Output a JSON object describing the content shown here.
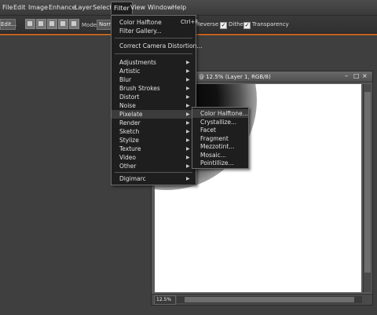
{
  "menubar": {
    "items": [
      "File",
      "Edit",
      "Image",
      "Enhance",
      "Layer",
      "Select",
      "Filter",
      "View",
      "Window",
      "Help"
    ]
  },
  "options_bar": {
    "edit_button": "Edit...",
    "mode_label": "Mode:",
    "mode_value": "Normal",
    "reverse": "Reverse",
    "dither": "Dither",
    "transparency": "Transparency",
    "check_mark": "✓"
  },
  "document": {
    "title": "@ 12.5% (Layer 1, RGB/8)",
    "zoom": "12.5%",
    "controls": {
      "minimize": "–",
      "maximize": "□",
      "close": "×"
    }
  },
  "filter_menu": {
    "items": [
      {
        "label": "Color Halftone",
        "shortcut": "Ctrl+F"
      },
      {
        "label": "Filter Gallery..."
      },
      {
        "label": "Correct Camera Distortion..."
      },
      {
        "label": "Adjustments",
        "arrow": "▶"
      },
      {
        "label": "Artistic",
        "arrow": "▶"
      },
      {
        "label": "Blur",
        "arrow": "▶"
      },
      {
        "label": "Brush Strokes",
        "arrow": "▶"
      },
      {
        "label": "Distort",
        "arrow": "▶"
      },
      {
        "label": "Noise",
        "arrow": "▶"
      },
      {
        "label": "Pixelate",
        "arrow": "▶"
      },
      {
        "label": "Render",
        "arrow": "▶"
      },
      {
        "label": "Sketch",
        "arrow": "▶"
      },
      {
        "label": "Stylize",
        "arrow": "▶"
      },
      {
        "label": "Texture",
        "arrow": "▶"
      },
      {
        "label": "Video",
        "arrow": "▶"
      },
      {
        "label": "Other",
        "arrow": "▶"
      },
      {
        "label": "Digimarc",
        "arrow": "▶"
      }
    ]
  },
  "pixelate_submenu": {
    "items": [
      "Color Halftone...",
      "Crystallize...",
      "Facet",
      "Fragment",
      "Mezzotint...",
      "Mosaic...",
      "Pointillize..."
    ]
  }
}
